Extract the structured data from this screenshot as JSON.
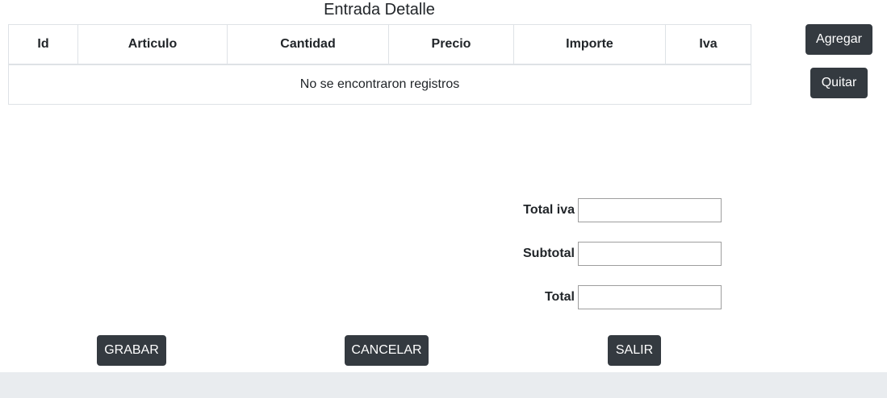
{
  "section": {
    "title": "Entrada Detalle"
  },
  "table": {
    "columns": [
      "Id",
      "Articulo",
      "Cantidad",
      "Precio",
      "Importe",
      "Iva"
    ],
    "empty_message": "No se encontraron registros"
  },
  "side_actions": {
    "add_label": "Agregar",
    "remove_label": "Quitar"
  },
  "totals": {
    "iva_label": "Total iva",
    "iva_value": "",
    "subtotal_label": "Subtotal",
    "subtotal_value": "",
    "total_label": "Total",
    "total_value": ""
  },
  "footer_actions": {
    "save_label": "GRABAR",
    "cancel_label": "CANCELAR",
    "exit_label": "SALIR"
  },
  "colors": {
    "button_dark": "#343a40",
    "table_border": "#dee2e6",
    "footer_bar": "#e9ecef"
  }
}
